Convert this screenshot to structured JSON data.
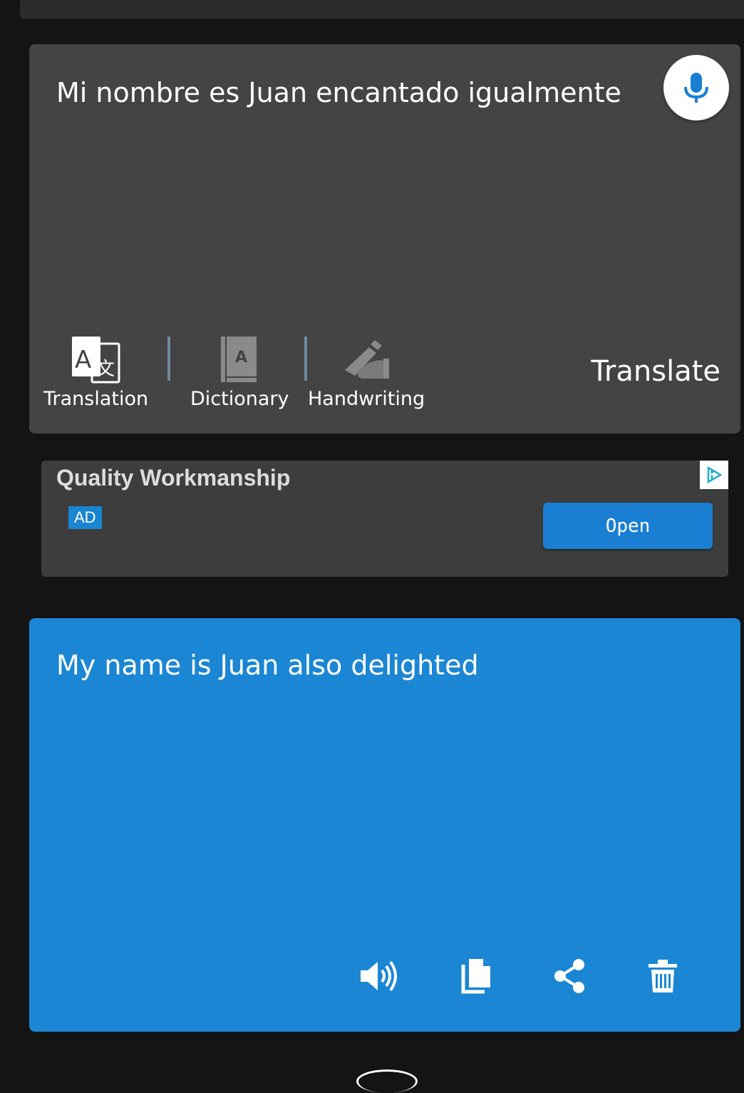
{
  "input": {
    "text": "Mi nombre es Juan encantado igualmente"
  },
  "tools": [
    {
      "label": "Translation",
      "icon": "translation-icon"
    },
    {
      "label": "Dictionary",
      "icon": "dictionary-icon"
    },
    {
      "label": "Handwriting",
      "icon": "handwriting-icon"
    }
  ],
  "translate_label": "Translate",
  "ad": {
    "title": "Quality Workmanship",
    "badge": "AD",
    "open_label": "Open"
  },
  "output": {
    "text": "My name is Juan also delighted",
    "actions": [
      "speaker-icon",
      "copy-icon",
      "share-icon",
      "delete-icon"
    ]
  },
  "colors": {
    "background": "#141414",
    "input_card": "#444444",
    "output_card": "#1b86d3",
    "accent": "#1a7fd2"
  }
}
